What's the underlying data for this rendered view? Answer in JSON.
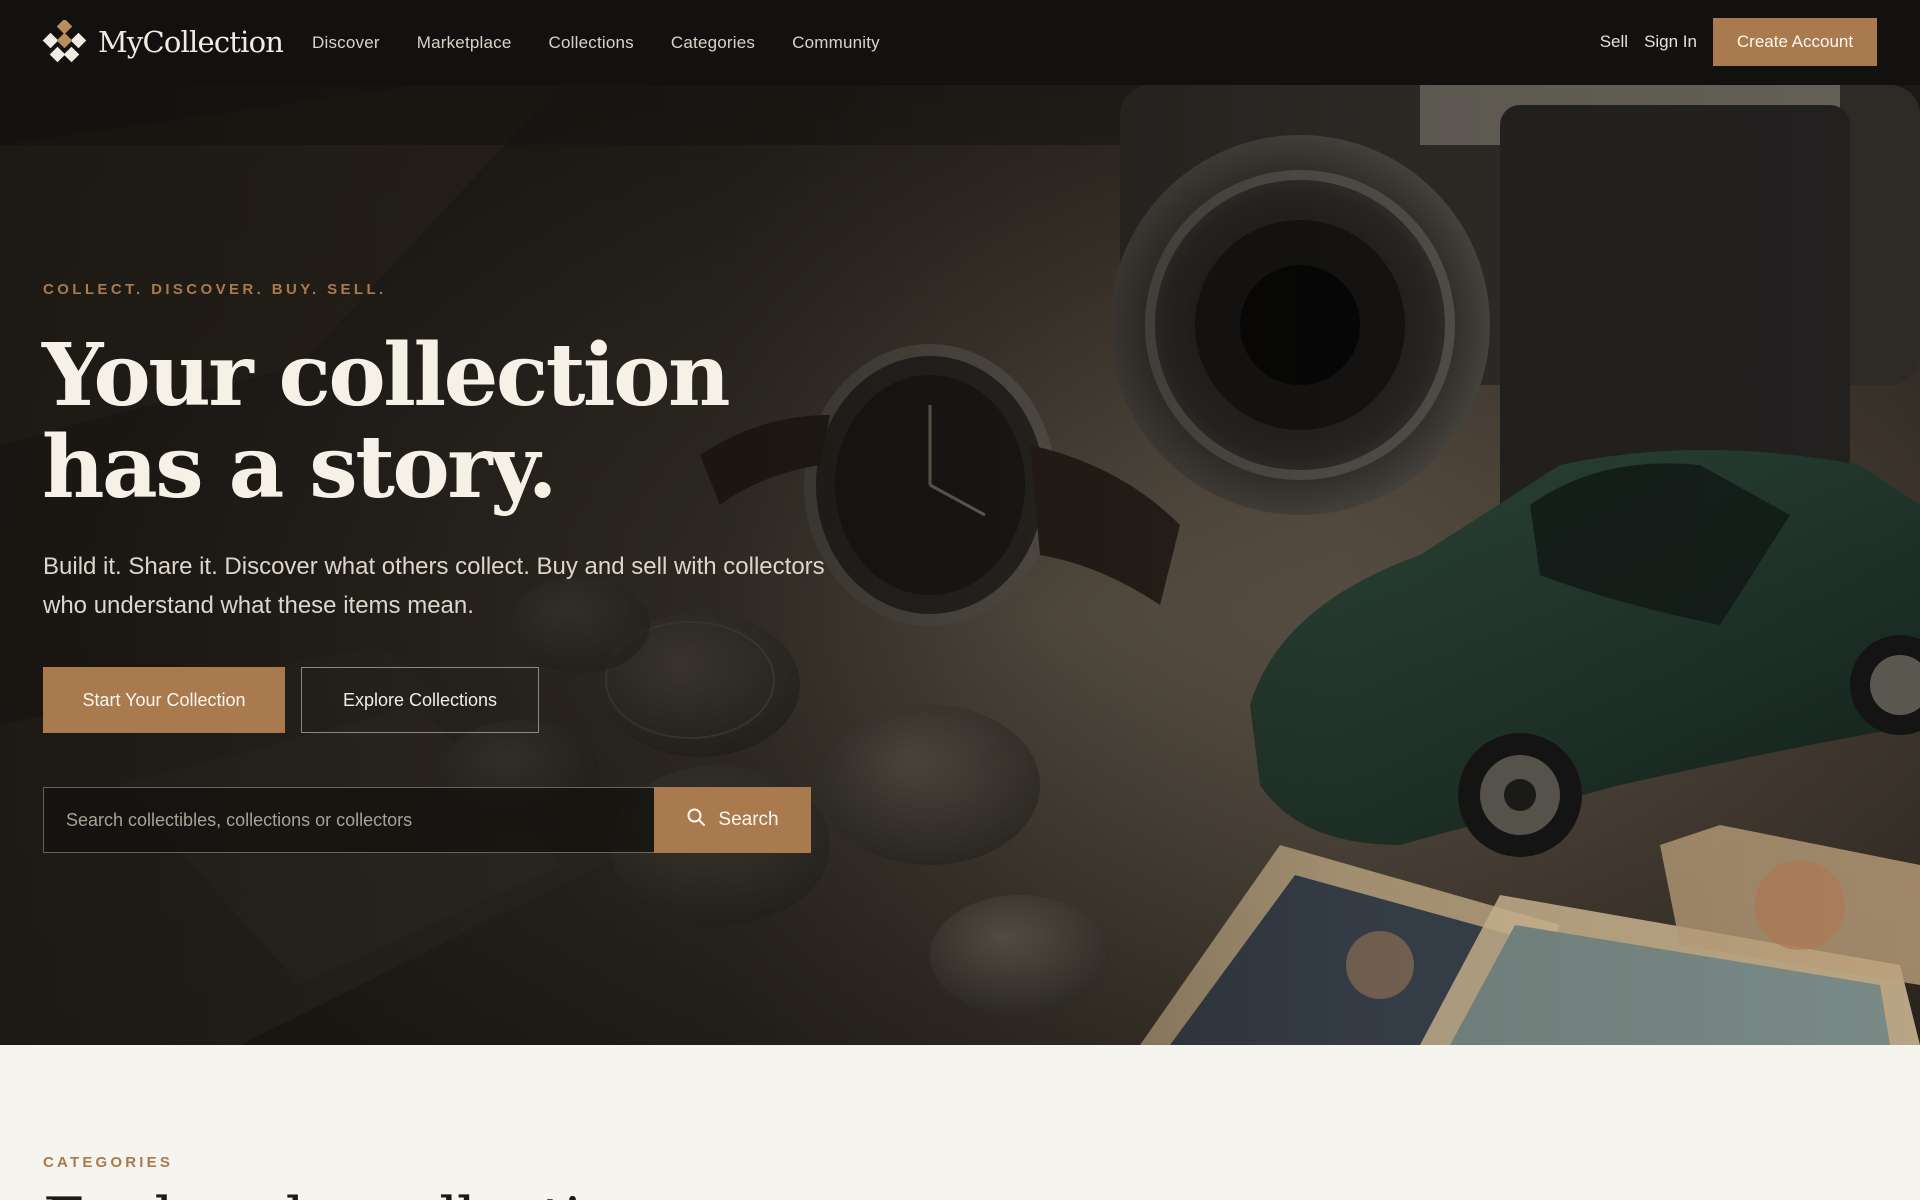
{
  "brand": {
    "name": "MyCollection",
    "logo_icon": "diamond-cluster-icon",
    "accent": "#a87a4e"
  },
  "nav": {
    "links": [
      "Discover",
      "Marketplace",
      "Collections",
      "Categories",
      "Community"
    ],
    "sell": "Sell",
    "sign_in": "Sign In",
    "create_account": "Create Account"
  },
  "hero": {
    "eyebrow": "COLLECT. DISCOVER. BUY. SELL.",
    "title": "Your collection has a story.",
    "subtitle": "Build it. Share it. Discover what others collect. Buy and sell with collectors who understand what these items mean.",
    "primary_cta": "Start Your Collection",
    "secondary_cta": "Explore Collections",
    "search": {
      "placeholder": "Search collectibles, collections or collectors",
      "button": "Search",
      "icon": "search-icon"
    }
  },
  "categories_section": {
    "eyebrow": "CATEGORIES",
    "title": "Explore by collection"
  },
  "colors": {
    "nav_bg": "#12110f",
    "accent": "#a87a4e",
    "page_bg": "#f5f4ef"
  }
}
